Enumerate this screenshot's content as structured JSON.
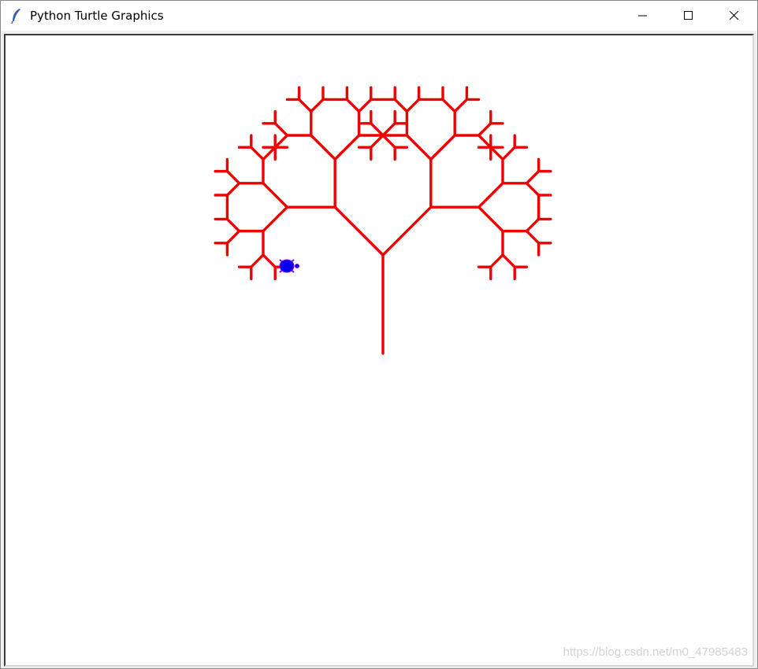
{
  "window": {
    "title": "Python Turtle Graphics",
    "icon": "feather-icon",
    "controls": [
      "minimize-icon",
      "maximize-icon",
      "close-icon"
    ]
  },
  "canvas": {
    "background": "#ffffff",
    "pen_color": "#ee0000",
    "turtle_color": "#0000ee",
    "turtle_outline": "#8000ff",
    "drawing": "fractal-tree",
    "recursion_levels": 6
  },
  "watermark": "https://blog.csdn.net/m0_47985483"
}
